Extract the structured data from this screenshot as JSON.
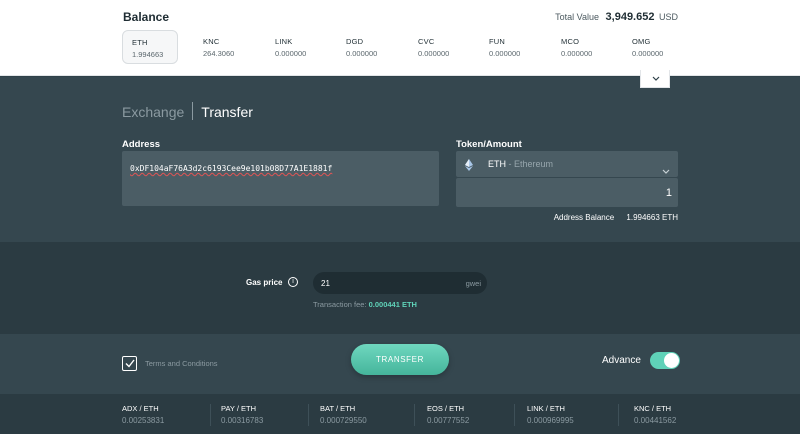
{
  "balance": {
    "title": "Balance",
    "total_label": "Total Value",
    "total_value": "3,949.652",
    "total_unit": "USD",
    "tokens": [
      {
        "symbol": "ETH",
        "amount": "1.994663",
        "active": true
      },
      {
        "symbol": "KNC",
        "amount": "264.3060"
      },
      {
        "symbol": "LINK",
        "amount": "0.000000"
      },
      {
        "symbol": "DGD",
        "amount": "0.000000"
      },
      {
        "symbol": "CVC",
        "amount": "0.000000"
      },
      {
        "symbol": "FUN",
        "amount": "0.000000"
      },
      {
        "symbol": "MCO",
        "amount": "0.000000"
      },
      {
        "symbol": "OMG",
        "amount": "0.000000"
      }
    ]
  },
  "tabs": {
    "exchange": "Exchange",
    "transfer": "Transfer"
  },
  "form": {
    "address_label": "Address",
    "address_value": "0xDF104aF76A3d2c6193Cee9e101b08D77A1E1881f",
    "token_amount_label": "Token/Amount",
    "token_symbol": "ETH",
    "token_name": " - Ethereum",
    "amount_value": "1",
    "address_balance_label": "Address Balance",
    "address_balance_value": "1.994663 ETH"
  },
  "gas": {
    "label": "Gas price",
    "value": "21",
    "unit": "gwei",
    "fee_label": "Transaction fee: ",
    "fee_value": "0.000441 ETH"
  },
  "actions": {
    "terms_label": "Terms and Conditions",
    "transfer_label": "TRANSFER",
    "advance_label": "Advance"
  },
  "rates": [
    {
      "pair": "ADX / ETH",
      "value": "0.00253831"
    },
    {
      "pair": "PAY / ETH",
      "value": "0.00316783"
    },
    {
      "pair": "BAT / ETH",
      "value": "0.000729550"
    },
    {
      "pair": "EOS / ETH",
      "value": "0.00777552"
    },
    {
      "pair": "LINK / ETH",
      "value": "0.000969995"
    },
    {
      "pair": "KNC / ETH",
      "value": "0.00441562"
    }
  ],
  "colors": {
    "accent": "#5fd2b8",
    "panel_dark": "#2b3b42",
    "panel": "#35474f",
    "input_bg": "#4b5d65"
  }
}
